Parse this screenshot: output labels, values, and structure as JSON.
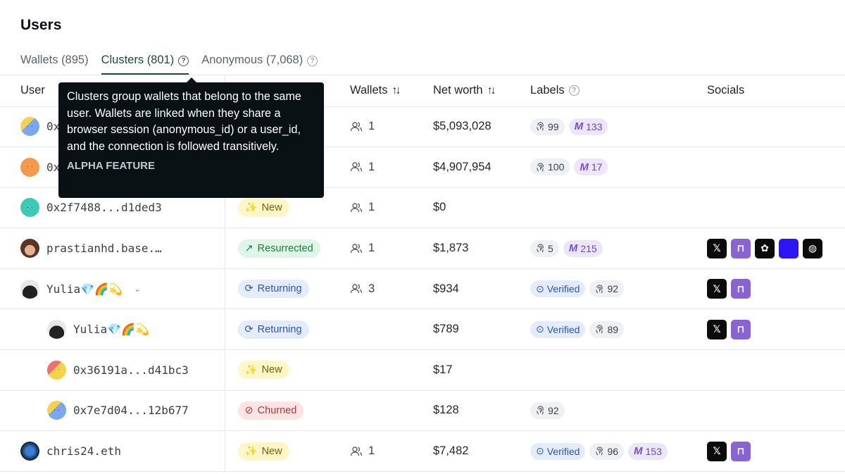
{
  "page": {
    "title": "Users"
  },
  "tabs": [
    {
      "label": "Wallets (895)"
    },
    {
      "label": "Clusters (801)"
    },
    {
      "label": "Anonymous (7,068)"
    }
  ],
  "table": {
    "headers": {
      "user": "User",
      "wallets": "Wallets",
      "net_worth": "Net worth",
      "labels": "Labels",
      "socials": "Socials"
    },
    "rows": [
      {
        "user": "0x",
        "wallets": "1",
        "net_worth": "$5,093,028",
        "labels": [
          "99",
          "133"
        ]
      },
      {
        "user": "0x",
        "wallets": "1",
        "net_worth": "$4,907,954",
        "labels": [
          "100",
          "17"
        ]
      },
      {
        "user": "0x2f7488...d1ded3",
        "status": "New",
        "wallets": "1",
        "net_worth": "$0"
      },
      {
        "user": "prastianhd.base.…",
        "status": "Resurrected",
        "wallets": "1",
        "net_worth": "$1,873",
        "labels": [
          "5",
          "215"
        ]
      },
      {
        "user": "Yulia💎🌈💫",
        "status": "Returning",
        "wallets": "3",
        "net_worth": "$934",
        "labels": [
          "Verified",
          "92"
        ]
      },
      {
        "user": "Yulia💎🌈💫",
        "status": "Returning",
        "net_worth": "$789",
        "labels": [
          "Verified",
          "89"
        ]
      },
      {
        "user": "0x36191a...d41bc3",
        "status": "New",
        "net_worth": "$17"
      },
      {
        "user": "0x7e7d04...12b677",
        "status": "Churned",
        "net_worth": "$128",
        "labels": [
          "92"
        ]
      },
      {
        "user": "chris24.eth",
        "status": "New",
        "wallets": "1",
        "net_worth": "$7,482",
        "labels": [
          "Verified",
          "96",
          "153"
        ]
      }
    ]
  },
  "tooltip": {
    "text": "Clusters group wallets that belong to the same user. Wallets are linked when they share a browser session (anonymous_id) or a user_id, and the connection is followed transitively.",
    "tag": "ALPHA FEATURE"
  },
  "colors": {
    "active_tab": "#1c4a3c",
    "tooltip_bg": "#0a1115"
  }
}
